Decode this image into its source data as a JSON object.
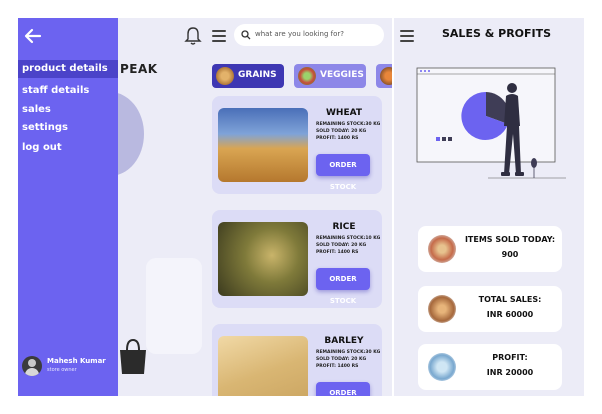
{
  "screen1": {
    "brand_partial": "PEAK",
    "menu": [
      {
        "label": "product details",
        "active": true
      },
      {
        "label": "staff details",
        "active": false
      },
      {
        "label": "sales",
        "active": false
      },
      {
        "label": "settings",
        "active": false
      },
      {
        "label": "log out",
        "active": false
      }
    ],
    "profile": {
      "name": "Mahesh Kumar",
      "role": "store owner"
    },
    "icons": [
      "back-arrow-icon",
      "bell-icon"
    ]
  },
  "screen2": {
    "search": {
      "placeholder": "what are you looking for?"
    },
    "tabs": [
      {
        "label": "GRAINS",
        "active": true
      },
      {
        "label": "VEGGIES",
        "active": false
      }
    ],
    "products": [
      {
        "name": "WHEAT",
        "remaining": "REMAINING STOCK:30 KG",
        "sold": "SOLD TODAY: 20 KG",
        "profit": "PROFIT: 1400 RS",
        "button": "ORDER STOCK"
      },
      {
        "name": "RICE",
        "remaining": "REMAINING STOCK:10 KG",
        "sold": "SOLD TODAY: 20 KG",
        "profit": "PROFIT: 1400 RS",
        "button": "ORDER STOCK"
      },
      {
        "name": "BARLEY",
        "remaining": "REMAINING STOCK:30 KG",
        "sold": "SOLD TODAY: 20 KG",
        "profit": "PROFIT: 1400 RS",
        "button": "ORDER STOCK"
      }
    ]
  },
  "screen3": {
    "title": "SALES & PROFITS",
    "stats": [
      {
        "label": "ITEMS SOLD TODAY:",
        "value": "900"
      },
      {
        "label": "TOTAL SALES:",
        "value": "INR 60000"
      },
      {
        "label": "PROFIT:",
        "value": "INR 20000"
      }
    ]
  },
  "colors": {
    "accent": "#6c63f0",
    "accent_dark": "#4b43c9",
    "background": "#ececf7",
    "card": "#dcdcf6"
  }
}
